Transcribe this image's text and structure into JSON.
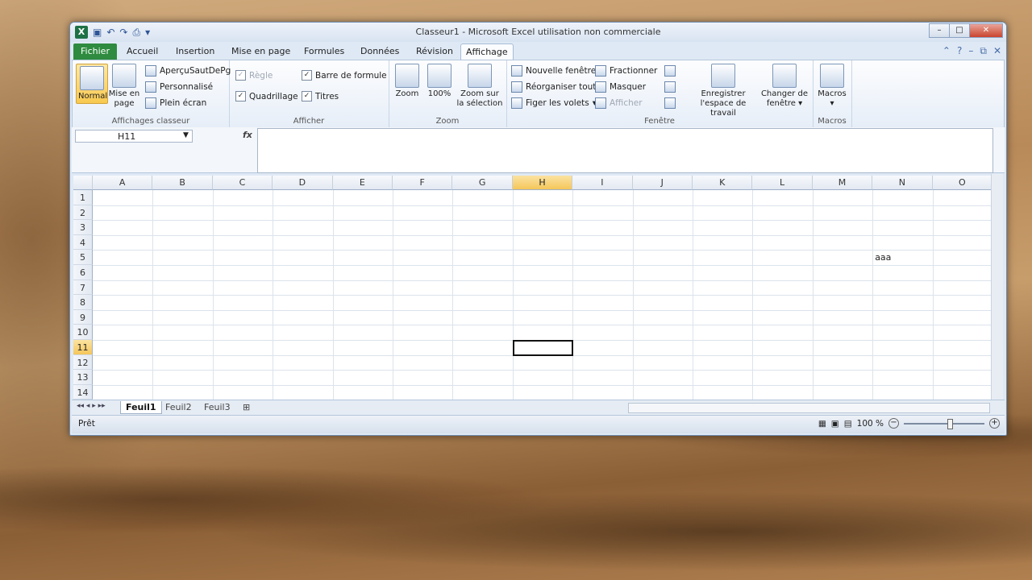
{
  "window": {
    "title": "Classeur1 - Microsoft Excel utilisation non commerciale"
  },
  "tabs": [
    "Fichier",
    "Accueil",
    "Insertion",
    "Mise en page",
    "Formules",
    "Données",
    "Révision",
    "Affichage"
  ],
  "active_tab": "Affichage",
  "ribbon": {
    "groups": {
      "affichages": "Affichages classeur",
      "afficher": "Afficher",
      "zoom": "Zoom",
      "fenetre": "Fenêtre",
      "macros": "Macros"
    },
    "normal": "Normal",
    "mise_en_page_1": "Mise en",
    "mise_en_page_2": "page",
    "apercu": "AperçuSautDePg",
    "personnalise": "Personnalisé",
    "plein_ecran": "Plein écran",
    "regle": "Règle",
    "quadrillage": "Quadrillage",
    "barre_formule": "Barre de formule",
    "titres": "Titres",
    "zoom": "Zoom",
    "zoom100": "100%",
    "zoom_sel_1": "Zoom sur",
    "zoom_sel_2": "la sélection",
    "nouvelle_fenetre": "Nouvelle fenêtre",
    "reorganiser": "Réorganiser tout",
    "figer": "Figer les volets",
    "fractionner": "Fractionner",
    "masquer": "Masquer",
    "afficher": "Afficher",
    "enregistrer_1": "Enregistrer",
    "enregistrer_2": "l'espace de travail",
    "changer_1": "Changer de",
    "changer_2": "fenêtre",
    "macros": "Macros"
  },
  "formula_bar": {
    "name_box": "H11",
    "fx": "fx"
  },
  "grid": {
    "columns": [
      "A",
      "B",
      "C",
      "D",
      "E",
      "F",
      "G",
      "H",
      "I",
      "J",
      "K",
      "L",
      "M",
      "N",
      "O"
    ],
    "rows": [
      "1",
      "2",
      "3",
      "4",
      "5",
      "6",
      "7",
      "8",
      "9",
      "10",
      "11",
      "12",
      "13",
      "14"
    ],
    "selected_col": "H",
    "selected_row": "11",
    "cell_n5": "aaa"
  },
  "sheets": [
    "Feuil1",
    "Feuil2",
    "Feuil3"
  ],
  "status": {
    "ready": "Prêt",
    "zoom": "100 %"
  }
}
